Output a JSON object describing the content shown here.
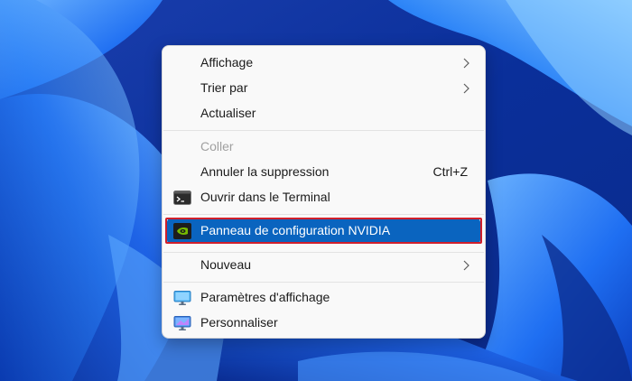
{
  "desktop": {
    "wallpaper": "windows-11-bloom-blue"
  },
  "context_menu": {
    "items": [
      {
        "label": "Affichage",
        "has_submenu": true
      },
      {
        "label": "Trier par",
        "has_submenu": true
      },
      {
        "label": "Actualiser"
      },
      {
        "label": "Coller",
        "disabled": true
      },
      {
        "label": "Annuler la suppression",
        "shortcut": "Ctrl+Z"
      },
      {
        "label": "Ouvrir dans le Terminal",
        "icon": "terminal-icon"
      },
      {
        "label": "Panneau de configuration NVIDIA",
        "icon": "nvidia-icon",
        "selected": true
      },
      {
        "label": "Nouveau",
        "has_submenu": true
      },
      {
        "label": "Paramètres d'affichage",
        "icon": "display-settings-icon"
      },
      {
        "label": "Personnaliser",
        "icon": "personalize-icon"
      }
    ]
  },
  "colors": {
    "selection": "#0a64bf",
    "highlight_outline": "#d01f2b"
  }
}
